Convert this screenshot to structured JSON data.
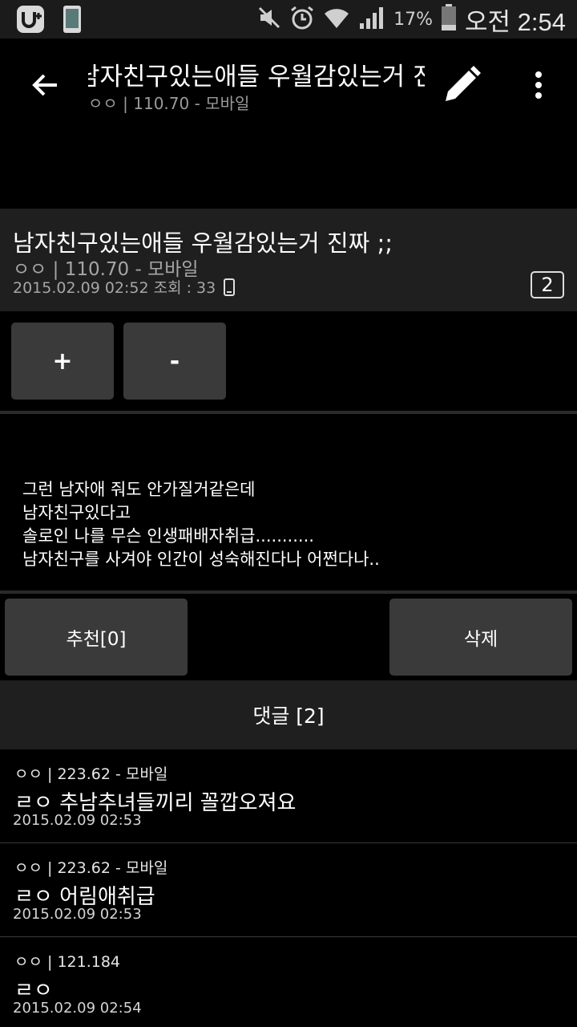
{
  "status_bar": {
    "battery_percent": "17%",
    "time": "오전 2:54",
    "icons": [
      "uplus-icon",
      "phone-icon",
      "mute-icon",
      "alarm-icon",
      "wifi-icon",
      "signal-icon",
      "battery-icon"
    ]
  },
  "app_bar": {
    "title": "남자친구있는애들 우월감있는거 진짜 ;;",
    "subtitle": "ㅇㅇ | 110.70 - 모바일"
  },
  "post": {
    "title": "남자친구있는애들 우월감있는거 진짜 ;;",
    "author": "ㅇㅇ | 110.70 - 모바일",
    "meta": "2015.02.09 02:52 조회 : 33",
    "comment_count": "2",
    "body": [
      "그런 남자애 줘도 안가질거같은데",
      "남자친구있다고",
      "솔로인 나를 무슨 인생패배자취급...........",
      "남자친구를 사겨야 인간이 성숙해진다나 어쩐다나.."
    ]
  },
  "vote": {
    "plus": "+",
    "minus": "-"
  },
  "actions": {
    "recommend": "추천[0]",
    "delete": "삭제"
  },
  "comments_header": "댓글 [2]",
  "comments": [
    {
      "author": "ㅇㅇ | 223.62 - 모바일",
      "text": "ㄹㅇ 추남추녀들끼리 꼴깝오져요",
      "date": "2015.02.09 02:53"
    },
    {
      "author": "ㅇㅇ | 223.62 - 모바일",
      "text": "ㄹㅇ 어림애취급",
      "date": "2015.02.09 02:53"
    },
    {
      "author": "ㅇㅇ | 121.184",
      "text": "ㄹㅇ",
      "date": "2015.02.09 02:54"
    }
  ],
  "colors": {
    "background": "#000000",
    "panel": "#1f1f1f",
    "button": "#3a3a3a"
  }
}
